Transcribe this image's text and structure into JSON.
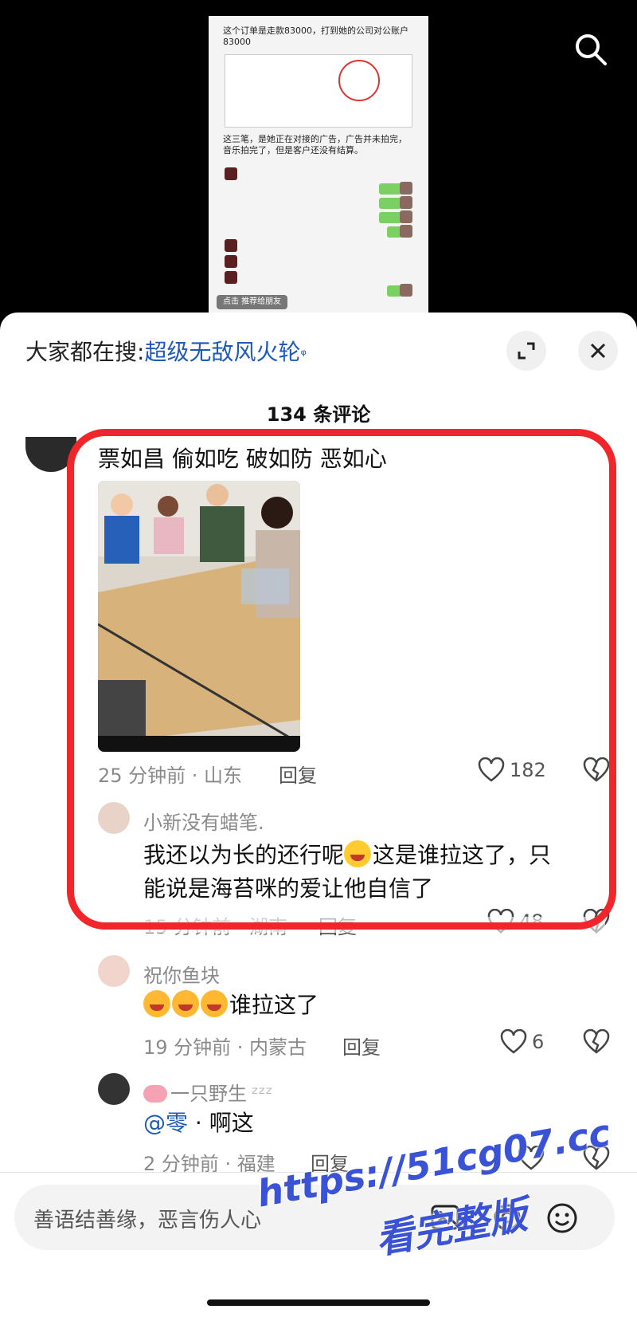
{
  "video": {
    "doc_line1": "这个订单是走款83000，打到她的公司对公账户83000",
    "doc_line2": "这三笔，是她正在对接的广告，广告并未拍完，音乐拍完了，但是客户还没有结算。",
    "share_label": "点击 推荐给朋友"
  },
  "search_panel": {
    "prefix": "大家都在搜:",
    "keyword": "超级无敌风火轮"
  },
  "comment_count": "134 条评论",
  "comments": [
    {
      "text": "票如昌 偷如吃 破如防 恶如心",
      "time_location": "25 分钟前 · 山东",
      "reply_label": "回复",
      "likes": "182"
    }
  ],
  "replies": [
    {
      "user": "小新没有蜡笔.",
      "text_line1": "我还以为长的还行呢",
      "text_line1b": "这是谁拉这了，只",
      "text_line2": "能说是海苔咪的爱让他自信了",
      "time_location": "15 分钟前 · 湖南",
      "reply_label": "回复",
      "likes": "48"
    },
    {
      "user": "祝你鱼块",
      "text": "谁拉这了",
      "time_location": "19 分钟前 · 内蒙古",
      "reply_label": "回复",
      "likes": "6"
    },
    {
      "user": "一只野生",
      "mention": "@零",
      "text": " · 啊这",
      "time_location": "2 分钟前 · 福建",
      "reply_label": "回复"
    }
  ],
  "input": {
    "placeholder": "善语结善缘，恶言伤人心"
  },
  "watermark": {
    "url": "https://51cg07.cc",
    "text": "看完整版"
  },
  "colors": {
    "highlight_box": "#f0262a",
    "keyword": "#1f5ab8",
    "watermark": "#3a52d6"
  }
}
